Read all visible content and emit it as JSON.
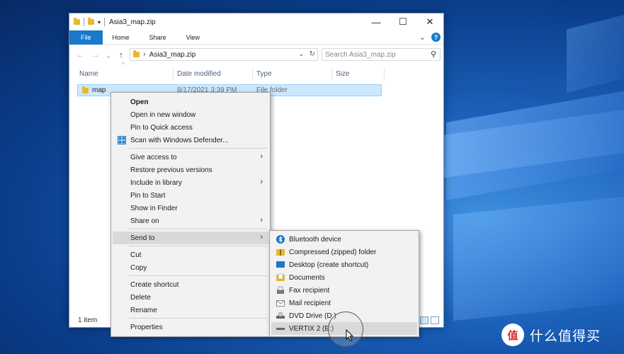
{
  "window": {
    "title": "Asia3_map.zip",
    "minimize": "—",
    "maximize": "☐",
    "close": "✕"
  },
  "ribbon": {
    "tabs": [
      "File",
      "Home",
      "Share",
      "View"
    ],
    "expand": "⌄",
    "help": "?"
  },
  "nav": {
    "back": "←",
    "forward": "→",
    "recent": "⌄",
    "up": "↑",
    "breadcrumb_sep": "›",
    "path": "Asia3_map.zip",
    "search_placeholder": "Search Asia3_map.zip"
  },
  "columns": [
    "Name",
    "Date modified",
    "Type",
    "Size"
  ],
  "files": [
    {
      "name": "map",
      "date": "8/17/2021 3:39 PM",
      "type": "File folder",
      "size": ""
    }
  ],
  "status": {
    "count": "1 item"
  },
  "context_menu": {
    "items": [
      {
        "label": "Open",
        "bold": true
      },
      {
        "label": "Open in new window"
      },
      {
        "label": "Pin to Quick access"
      },
      {
        "label": "Scan with Windows Defender..."
      },
      {
        "label": "Give access to",
        "submenu": true
      },
      {
        "label": "Restore previous versions"
      },
      {
        "label": "Include in library",
        "submenu": true
      },
      {
        "label": "Pin to Start"
      },
      {
        "label": "Show in Finder"
      },
      {
        "label": "Share on",
        "submenu": true
      },
      {
        "label": "Send to",
        "submenu": true,
        "highlighted": true
      },
      {
        "label": "Cut"
      },
      {
        "label": "Copy"
      },
      {
        "label": "Create shortcut"
      },
      {
        "label": "Delete"
      },
      {
        "label": "Rename"
      },
      {
        "label": "Properties"
      }
    ]
  },
  "send_to": {
    "items": [
      {
        "label": "Bluetooth device",
        "icon": "bluetooth-icon"
      },
      {
        "label": "Compressed (zipped) folder",
        "icon": "zip-folder-icon"
      },
      {
        "label": "Desktop (create shortcut)",
        "icon": "desktop-icon"
      },
      {
        "label": "Documents",
        "icon": "documents-icon"
      },
      {
        "label": "Fax recipient",
        "icon": "fax-icon"
      },
      {
        "label": "Mail recipient",
        "icon": "mail-icon"
      },
      {
        "label": "DVD Drive (D:)",
        "icon": "dvd-drive-icon"
      },
      {
        "label": "VERTIX 2 (E:)",
        "icon": "usb-drive-icon",
        "highlighted": true
      }
    ]
  },
  "watermark": {
    "logo": "值",
    "text": "什么值得买"
  },
  "colors": {
    "accent": "#1979ca",
    "selection": "#cce8ff",
    "menu_bg": "#f2f2f2"
  }
}
